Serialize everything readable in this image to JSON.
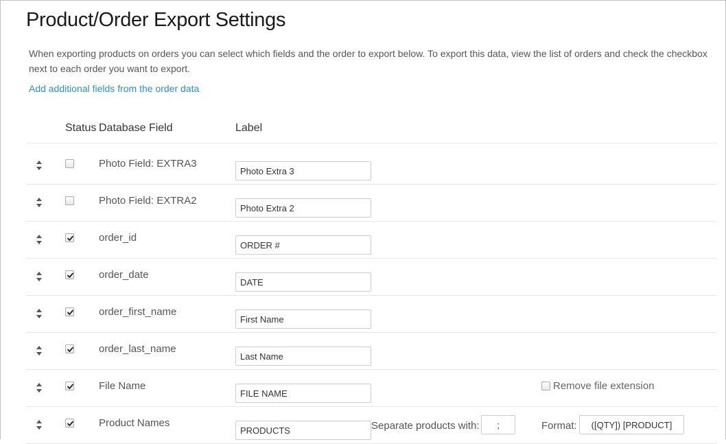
{
  "page": {
    "title": "Product/Order Export Settings",
    "description": "When exporting products on orders you can select which fields and the order to export below. To export this data, view the list of orders and check the checkbox next to each order you want to export.",
    "add_link": "Add additional fields from the order data"
  },
  "table": {
    "headers": {
      "status": "Status",
      "database_field": "Database Field",
      "label": "Label"
    },
    "rows": [
      {
        "field": "Photo Field: EXTRA3",
        "checked": false,
        "label": "Photo Extra 3"
      },
      {
        "field": "Photo Field: EXTRA2",
        "checked": false,
        "label": "Photo Extra 2"
      },
      {
        "field": "order_id",
        "checked": true,
        "label": "ORDER #"
      },
      {
        "field": "order_date",
        "checked": true,
        "label": "DATE"
      },
      {
        "field": "order_first_name",
        "checked": true,
        "label": "First Name"
      },
      {
        "field": "order_last_name",
        "checked": true,
        "label": "Last Name"
      },
      {
        "field": "File Name",
        "checked": true,
        "label": "FILE NAME",
        "extra_option": {
          "label": "Remove file extension",
          "checked": false
        }
      },
      {
        "field": "Product Names",
        "checked": true,
        "label": "PRODUCTS",
        "separator": {
          "label": "Separate products with:",
          "value": ";"
        },
        "format": {
          "label": "Format:",
          "value": "([QTY]) [PRODUCT]"
        }
      }
    ]
  },
  "icons": {
    "handle": "sort-arrows-icon",
    "check": "check-icon"
  },
  "colors": {
    "link": "#2b8fd0",
    "text": "#333333",
    "muted": "#555555",
    "rule": "#e6e6e6"
  }
}
